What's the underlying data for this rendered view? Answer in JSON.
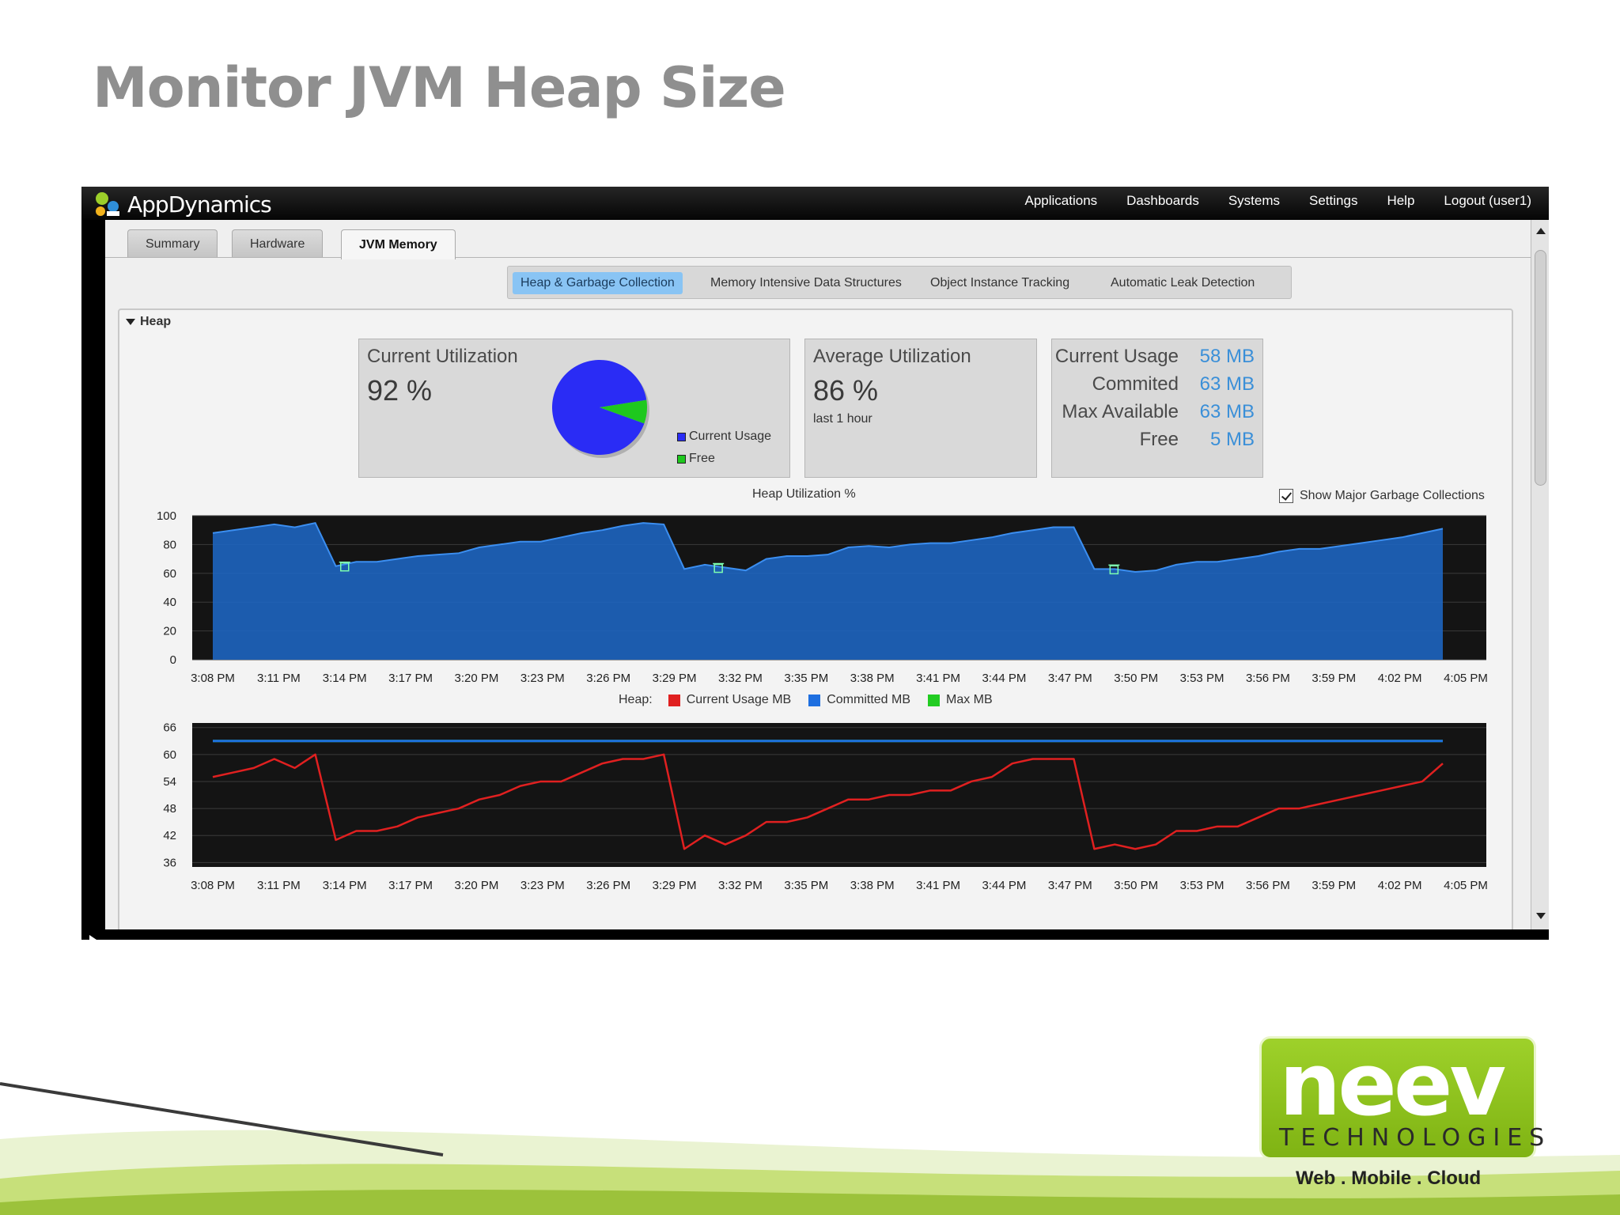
{
  "slide": {
    "title": "Monitor JVM Heap Size",
    "tagline": "Web . Mobile . Cloud",
    "brand_word": "neev",
    "brand_sub": "TECHNOLOGIES"
  },
  "app": {
    "name": "AppDynamics",
    "nav": [
      "Applications",
      "Dashboards",
      "Systems",
      "Settings",
      "Help",
      "Logout (user1)"
    ],
    "tabs": [
      "Summary",
      "Hardware",
      "JVM Memory"
    ],
    "active_tab": "JVM Memory",
    "subtabs": [
      "Heap & Garbage Collection",
      "Memory Intensive Data Structures",
      "Object Instance Tracking",
      "Automatic Leak Detection"
    ],
    "active_subtab": "Heap & Garbage Collection"
  },
  "heap": {
    "section_label": "Heap",
    "current_util": {
      "label": "Current Utilization",
      "value": "92 %",
      "legend_usage": "Current Usage",
      "legend_free": "Free",
      "pie_fraction_used": 0.92
    },
    "average_util": {
      "label": "Average Utilization",
      "value": "86 %",
      "sub": "last 1 hour"
    },
    "stats": [
      {
        "label": "Current Usage",
        "value": "58 MB"
      },
      {
        "label": "Commited",
        "value": "63 MB"
      },
      {
        "label": "Max Available",
        "value": "63 MB"
      },
      {
        "label": "Free",
        "value": "5 MB"
      }
    ],
    "show_gc_label": "Show Major Garbage Collections",
    "show_gc_checked": true
  },
  "colors": {
    "usage_blue": "#2a2cf5",
    "free_green": "#1ec81e",
    "area_blue": "#1d68c9",
    "red": "#e02020",
    "committed": "#1e6fe0",
    "max": "#22cc22",
    "stat_value": "#3a8fd8"
  },
  "chart_data": [
    {
      "type": "area",
      "title": "Heap Utilization %",
      "x": [
        "3:08 PM",
        "3:11 PM",
        "3:14 PM",
        "3:17 PM",
        "3:20 PM",
        "3:23 PM",
        "3:26 PM",
        "3:29 PM",
        "3:32 PM",
        "3:35 PM",
        "3:38 PM",
        "3:41 PM",
        "3:44 PM",
        "3:47 PM",
        "3:50 PM",
        "3:53 PM",
        "3:56 PM",
        "3:59 PM",
        "4:02 PM",
        "4:05 PM"
      ],
      "yticks": [
        0,
        20,
        40,
        60,
        80,
        100
      ],
      "ylim": [
        0,
        100
      ],
      "series": [
        {
          "values": [
            88,
            90,
            92,
            94,
            92,
            95,
            65,
            68,
            68,
            70,
            72,
            73,
            74,
            78,
            80,
            82,
            82,
            85,
            88,
            90,
            93,
            95,
            94,
            63,
            66,
            64,
            62,
            70,
            72,
            72,
            73,
            78,
            79,
            78,
            80,
            81,
            81,
            83,
            85,
            88,
            90,
            92,
            92,
            63,
            63,
            61,
            62,
            66,
            68,
            68,
            70,
            72,
            75,
            77,
            77,
            79,
            81,
            83,
            85,
            88,
            91
          ]
        }
      ],
      "gc_events": [
        "3:14 PM",
        "3:31 PM",
        "3:49 PM"
      ]
    },
    {
      "type": "line",
      "legend_title": "Heap:",
      "x": [
        "3:08 PM",
        "3:11 PM",
        "3:14 PM",
        "3:17 PM",
        "3:20 PM",
        "3:23 PM",
        "3:26 PM",
        "3:29 PM",
        "3:32 PM",
        "3:35 PM",
        "3:38 PM",
        "3:41 PM",
        "3:44 PM",
        "3:47 PM",
        "3:50 PM",
        "3:53 PM",
        "3:56 PM",
        "3:59 PM",
        "4:02 PM",
        "4:05 PM"
      ],
      "yticks": [
        36,
        42,
        48,
        54,
        60,
        66
      ],
      "ylim": [
        35,
        67
      ],
      "series": [
        {
          "name": "Current Usage MB",
          "values": [
            55,
            56,
            57,
            59,
            57,
            60,
            41,
            43,
            43,
            44,
            46,
            47,
            48,
            50,
            51,
            53,
            54,
            54,
            56,
            58,
            59,
            59,
            60,
            39,
            42,
            40,
            42,
            45,
            45,
            46,
            48,
            50,
            50,
            51,
            51,
            52,
            52,
            54,
            55,
            58,
            59,
            59,
            59,
            39,
            40,
            39,
            40,
            43,
            43,
            44,
            44,
            46,
            48,
            48,
            49,
            50,
            51,
            52,
            53,
            54,
            58
          ]
        },
        {
          "name": "Committed MB",
          "values": [
            63,
            63
          ]
        },
        {
          "name": "Max MB",
          "values": [
            63,
            63
          ]
        }
      ]
    }
  ]
}
